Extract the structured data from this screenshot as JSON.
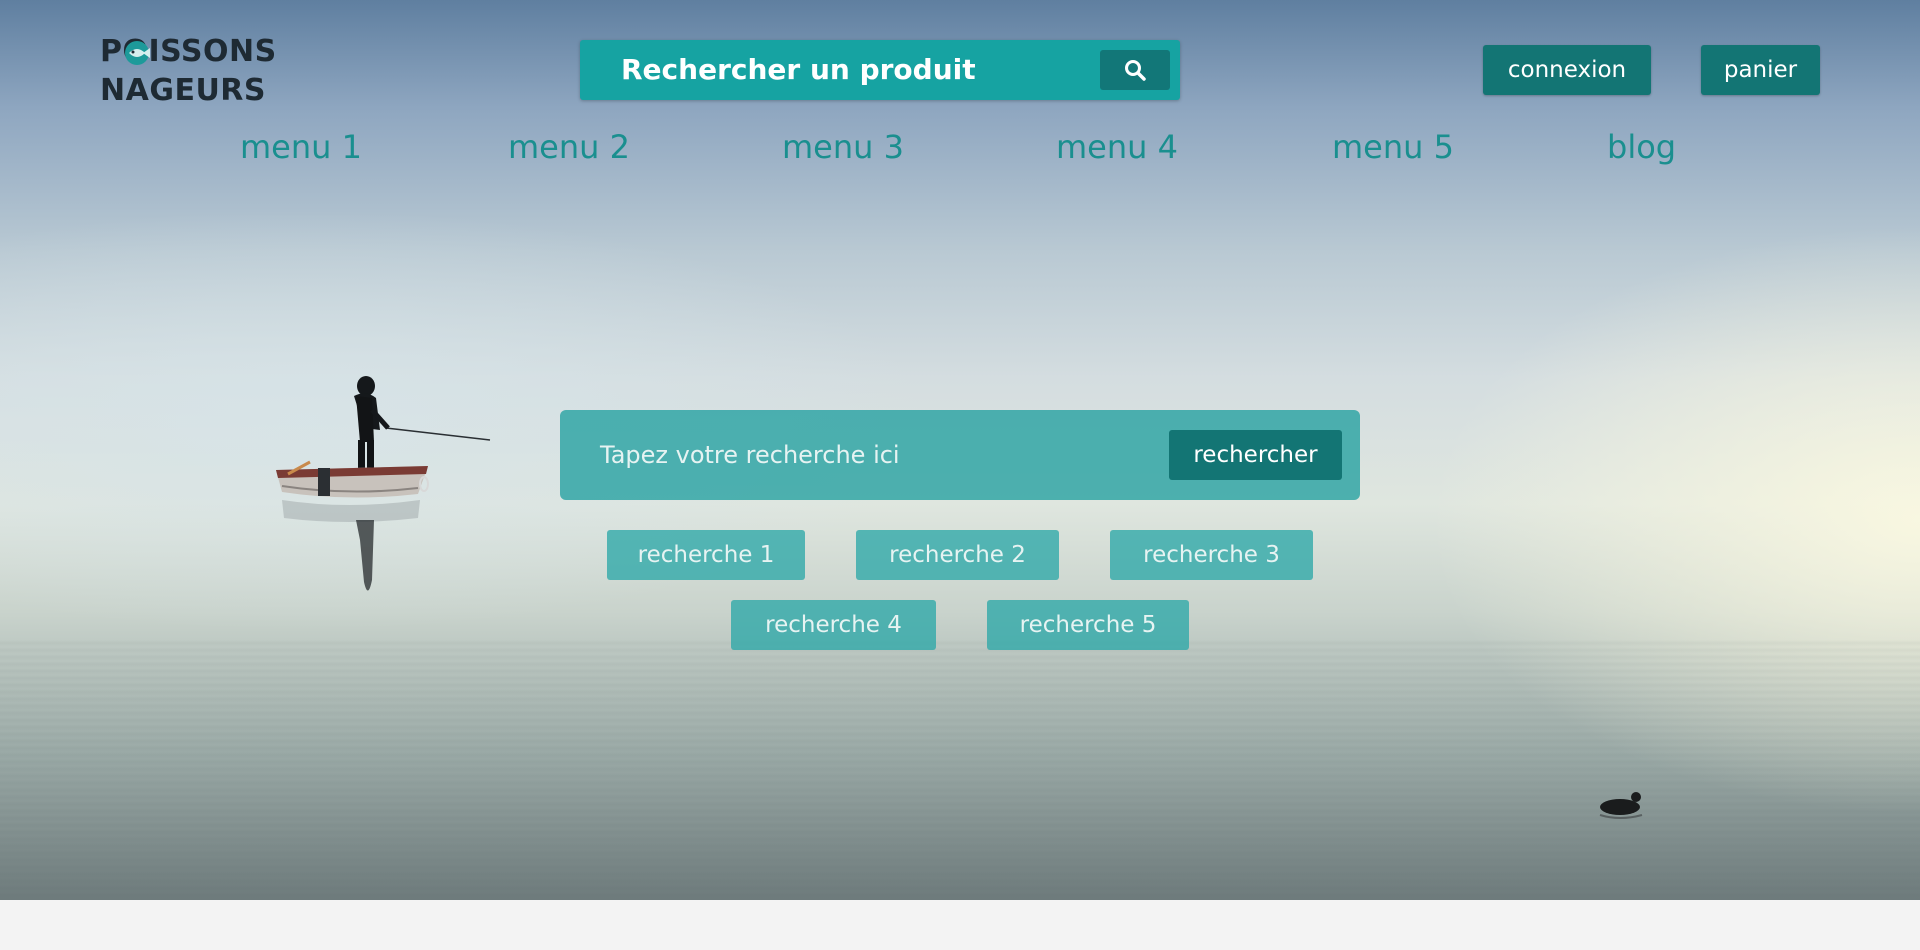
{
  "brand": {
    "name_line1": "POISSONS",
    "name_line2": "NAGEURS"
  },
  "header": {
    "search_label": "Rechercher un produit",
    "search_icon": "search-icon",
    "login_label": "connexion",
    "cart_label": "panier"
  },
  "nav": {
    "items": [
      {
        "label": "menu 1"
      },
      {
        "label": "menu 2"
      },
      {
        "label": "menu 3"
      },
      {
        "label": "menu 4"
      },
      {
        "label": "menu 5"
      },
      {
        "label": "blog"
      }
    ]
  },
  "hero": {
    "search_placeholder": "Tapez votre recherche ici",
    "search_button": "rechercher",
    "suggestions": [
      {
        "label": "recherche 1"
      },
      {
        "label": "recherche 2"
      },
      {
        "label": "recherche 3"
      },
      {
        "label": "recherche 4"
      },
      {
        "label": "recherche 5"
      }
    ]
  },
  "colors": {
    "accent": "#16a3a2",
    "accent_dark": "#137574",
    "nav_text": "#1a8f8f",
    "logo_text": "#1e2a33"
  }
}
